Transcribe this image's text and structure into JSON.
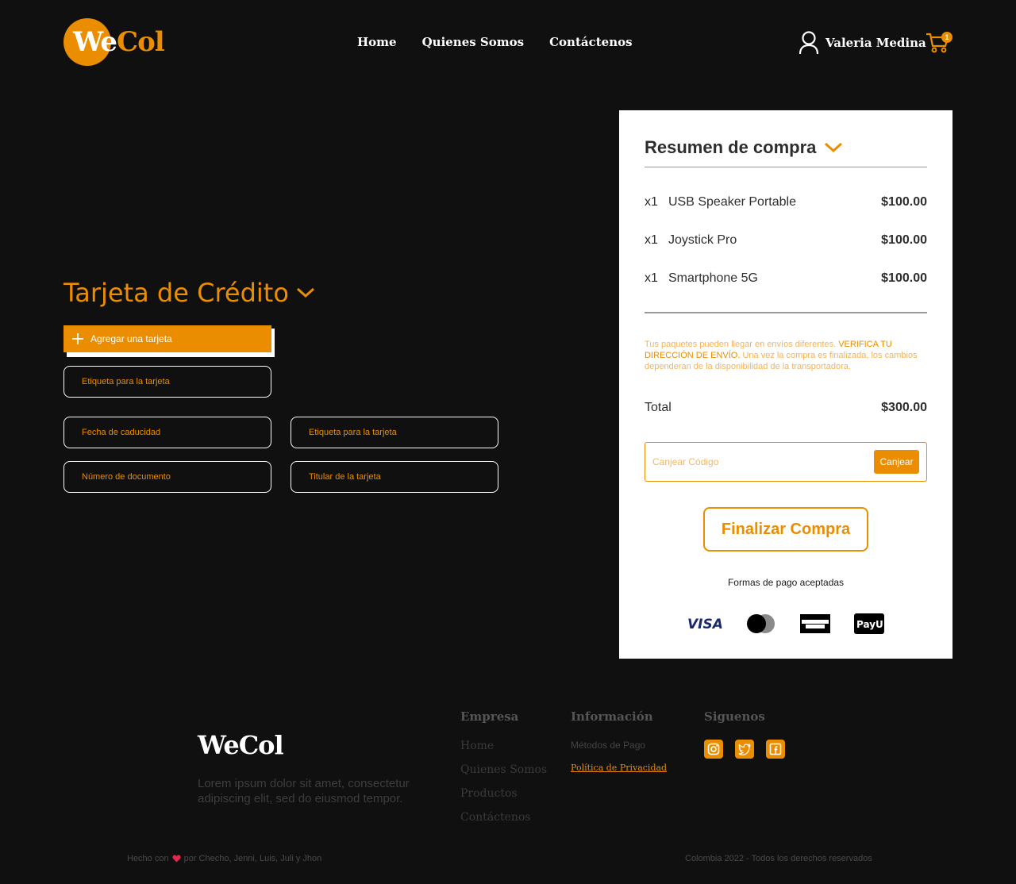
{
  "brand": {
    "logo_part1": "We",
    "logo_part2": "Col",
    "accent": "#ea8d00"
  },
  "nav": [
    "Home",
    "Quienes Somos",
    "Contáctenos"
  ],
  "user": {
    "name": "Valeria Medina",
    "cart_count": "1"
  },
  "credit_card": {
    "title": "Tarjeta de Crédito",
    "add_button": "Agregar una tarjeta",
    "fields": {
      "label1": "Etiqueta para la tarjeta",
      "expiry": "Fecha de caducidad",
      "label2": "Etiqueta para la tarjeta",
      "document": "Número de documento",
      "holder": "Titular de la tarjeta"
    }
  },
  "summary": {
    "title": "Resumen de compra",
    "items": [
      {
        "qty": "x1",
        "name": "USB Speaker Portable",
        "price": "$100.00"
      },
      {
        "qty": "x1",
        "name": "Joystick Pro",
        "price": "$100.00"
      },
      {
        "qty": "x1",
        "name": "Smartphone 5G",
        "price": "$100.00"
      }
    ],
    "note_pre": "Tus paquetes pueden llegar en envíos diferentes. ",
    "note_highlight": "VERIFICA TU DIRECCIÓN DE ENVÍO.",
    "note_post": " Una vez la compra es finalizada, los cambios dependeran de la disponibilidad de la transportadora.",
    "total_label": "Total",
    "total_value": "$300.00",
    "code_placeholder": "Canjear Código",
    "code_button": "Canjear",
    "finish_button": "Finalizar Compra",
    "payment_title": "Formas de pago aceptadas",
    "payment_methods": [
      "visa-icon",
      "mastercard-icon",
      "amex-icon",
      "payu-icon"
    ]
  },
  "footer": {
    "logo": "WeCol",
    "description": "Lorem ipsum dolor sit amet, consectetur adipiscing elit, sed do eiusmod tempor.",
    "company": {
      "title": "Empresa",
      "links": [
        "Home",
        "Quienes Somos",
        "Productos",
        "Contáctenos"
      ]
    },
    "info": {
      "title": "Información",
      "payment": "Métodos de Pago",
      "privacy": "Política de Privacidad"
    },
    "social": {
      "title": "Siguenos",
      "icons": [
        "instagram-icon",
        "twitter-icon",
        "facebook-icon"
      ]
    },
    "made_with_pre": "Hecho con",
    "made_with_post": "por Checho, Jenni, Luis, Juli y Jhon",
    "copyright": "Colombia 2022 - Todos los derechos reservados"
  }
}
